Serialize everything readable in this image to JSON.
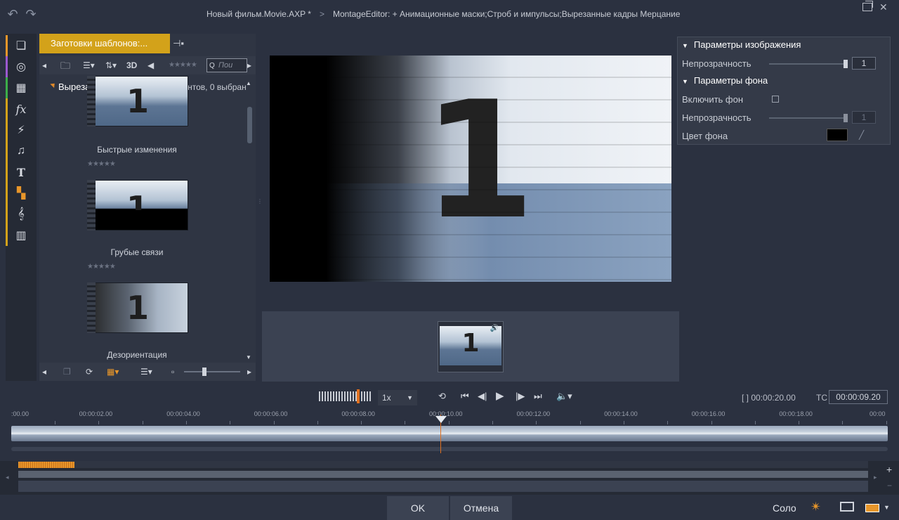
{
  "title": {
    "project": "Новый фильм.Movie.AXP *",
    "separator": ">",
    "editor": "MontageEditor: + Анимационные маски;Строб и импульсы;Вырезанные кадры  Мерцание"
  },
  "icons": [
    "undo-icon",
    "redo-icon",
    "restore-window-icon",
    "close-icon"
  ],
  "sidebar": {
    "items": [
      {
        "name": "projects-bin",
        "glyph": "❏",
        "color": "#e8962a"
      },
      {
        "name": "media",
        "glyph": "◎",
        "color": "#9b59d0"
      },
      {
        "name": "transitions",
        "glyph": "▦",
        "color": "#3cae4a"
      },
      {
        "name": "effects",
        "glyph": "fx",
        "color": "#d3a21a"
      },
      {
        "name": "montage",
        "glyph": "⚡",
        "color": "#d3a21a"
      },
      {
        "name": "music",
        "glyph": "♫",
        "color": "#d3a21a"
      },
      {
        "name": "titles",
        "glyph": "T",
        "color": "#d3a21a"
      },
      {
        "name": "montage-templates",
        "glyph": "▚",
        "color": "#d3a21a"
      },
      {
        "name": "scorefitter",
        "glyph": "𝄞",
        "color": "#d3a21a"
      },
      {
        "name": "sound-effects",
        "glyph": "▥",
        "color": "#d3a21a"
      }
    ]
  },
  "library": {
    "tab_label": "Заготовки шаблонов:...",
    "toolbar": {
      "view_3d": "3D",
      "stars": "★★★★★",
      "search_placeholder": "Пои"
    },
    "group": {
      "name": "Вырезанные кадры",
      "count": "20 элементов, 0 выбран"
    },
    "items": [
      {
        "label": "Быстрые изменения",
        "thumb_digit": "1",
        "rating": "★★★★★"
      },
      {
        "label": "Грубые связи",
        "thumb_digit": "1",
        "rating": "★★★★★"
      },
      {
        "label": "Дезориентация",
        "thumb_digit": "1",
        "rating": ""
      }
    ]
  },
  "preview": {
    "digit": "1"
  },
  "params": {
    "image_section": "Параметры изображения",
    "opacity_label": "Непрозрачность",
    "opacity_value": "1",
    "opacity_level": 1.0,
    "bg_section": "Параметры фона",
    "enable_bg_label": "Включить фон",
    "enable_bg_checked": false,
    "bg_opacity_label": "Непрозрачность",
    "bg_opacity_value": "1",
    "bg_opacity_level": 1.0,
    "bg_color_label": "Цвет фона",
    "bg_color": "#000000"
  },
  "filmstrip": {
    "clip_digit": "1"
  },
  "transport": {
    "speed": "1x",
    "duration_prefix": "[ ]",
    "duration": "00:00:20.00",
    "tc_label": "TC",
    "timecode": "00:00:09.20",
    "ruler": [
      ":00.00",
      "00:00:02.00",
      "00:00:04.00",
      "00:00:06.00",
      "00:00:08.00",
      "00:00:10.00",
      "00:00:12.00",
      "00:00:14.00",
      "00:00:16.00",
      "00:00:18.00",
      "00:00"
    ],
    "playhead_seconds": 9.8
  },
  "bottom": {
    "ok": "OK",
    "cancel": "Отмена",
    "solo": "Соло"
  }
}
